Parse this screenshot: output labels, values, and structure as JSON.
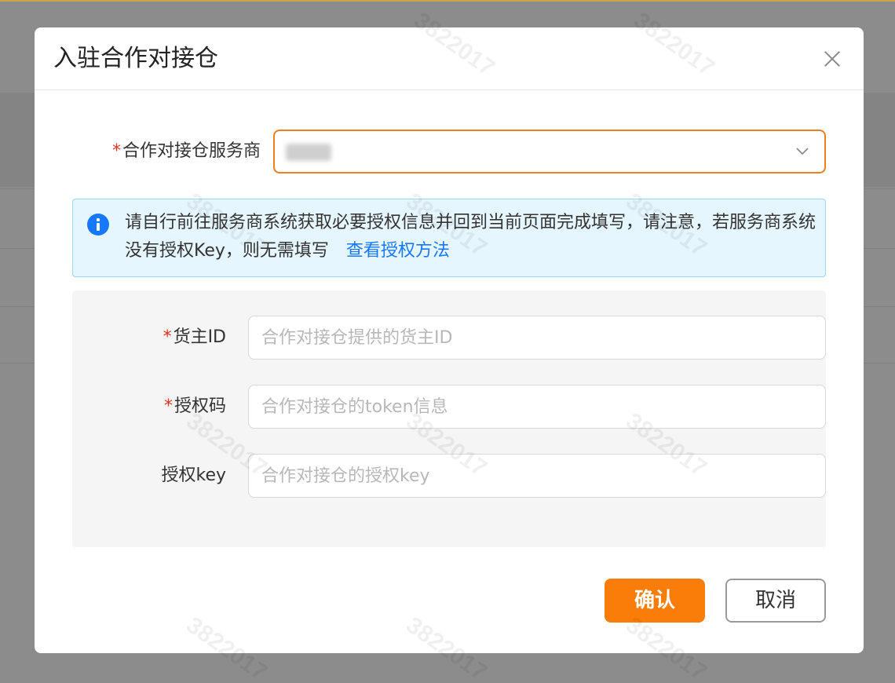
{
  "dialog": {
    "title": "入驻合作对接仓"
  },
  "form": {
    "provider": {
      "label": "合作对接仓服务商",
      "required_mark": "*",
      "value": ""
    },
    "alert": {
      "text": "请自行前往服务商系统获取必要授权信息并回到当前页面完成填写，请注意，若服务商系统没有授权Key，则无需填写",
      "link_text": "查看授权方法"
    },
    "owner_id": {
      "label": "货主ID",
      "required_mark": "*",
      "placeholder": "合作对接仓提供的货主ID"
    },
    "auth_code": {
      "label": "授权码",
      "required_mark": "*",
      "placeholder": "合作对接仓的token信息"
    },
    "auth_key": {
      "label": "授权key",
      "placeholder": "合作对接仓的授权key"
    }
  },
  "actions": {
    "confirm_label": "确认",
    "cancel_label": "取消"
  },
  "watermark": {
    "text": "3822017"
  },
  "colors": {
    "accent": "#fb7d09",
    "focus_border": "#f07d20",
    "link": "#1677ff",
    "required": "#e0341c",
    "alert_bg": "#e6f6fe"
  }
}
